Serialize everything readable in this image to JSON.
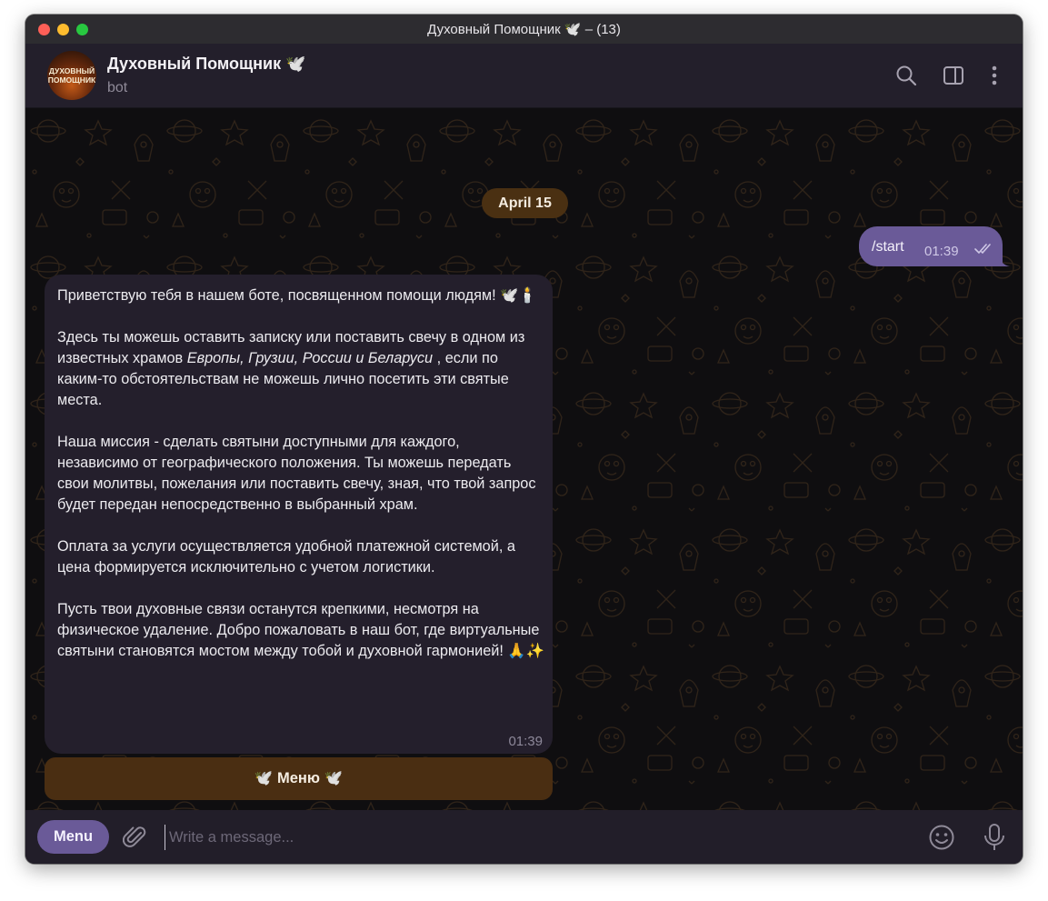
{
  "window": {
    "title": "Духовный Помощник 🕊️ – (13)"
  },
  "header": {
    "avatar_text_line1": "ДУХОВНЫЙ",
    "avatar_text_line2": "ПОМОЩНИК",
    "name": "Духовный Помощник 🕊️",
    "status": "bot",
    "icons": [
      "search-icon",
      "sidebar-toggle-icon",
      "more-vertical-icon"
    ]
  },
  "chat": {
    "date_label": "April 15",
    "outgoing": {
      "text": "/start",
      "time": "01:39",
      "status_icon": "double-check-icon"
    },
    "incoming": {
      "paragraphs": [
        "Приветствую тебя в нашем боте, посвященном помощи людям! 🕊️🕯️",
        "Здесь ты можешь оставить записку или поставить свечу в одном из известных храмов Европы, Грузии, России и Беларуси , если по каким-то обстоятельствам не можешь лично посетить эти святые места.",
        "Наша миссия - сделать святыни доступными для каждого, независимо от географического положения. Ты можешь передать свои молитвы, пожелания или поставить свечу, зная, что твой запрос будет передан непосредственно в выбранный храм.",
        "Оплата за услуги осуществляется удобной платежной системой, а цена формируется исключительно с учетом логистики.",
        "Пусть твои духовные связи останутся крепкими, несмотря на физическое удаление. Добро пожаловать в наш бот, где виртуальные святыни становятся мостом между тобой и духовной гармонией! 🙏✨"
      ],
      "p2_before": "Здесь ты можешь оставить записку или поставить свечу в одном из известных храмов ",
      "p2_italic": "Европы, Грузии, России и Беларуси",
      "p2_after": " , если по каким-то обстоятельствам не можешь лично посетить эти святые места.",
      "time": "01:39"
    },
    "inline_button": "🕊️ Меню 🕊️"
  },
  "composer": {
    "menu_label": "Menu",
    "placeholder": "Write a message...",
    "value": ""
  },
  "colors": {
    "accent": "#6a5a98",
    "inline_button": "#4a2e12",
    "date_pill": "#4a3012",
    "incoming_bubble": "#241f2c"
  }
}
